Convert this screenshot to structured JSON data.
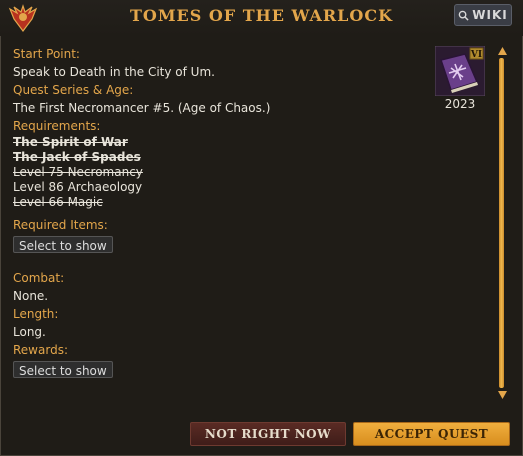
{
  "window": {
    "title": "TOMES OF THE WARLOCK",
    "wiki_label": "WIKI"
  },
  "quest": {
    "start_point_label": "Start Point:",
    "start_point": "Speak to Death in the City of Um.",
    "series_label": "Quest Series & Age:",
    "series": "The First Necromancer #5. (Age of Chaos.)",
    "requirements_label": "Requirements:",
    "requirements": [
      {
        "text": "The Spirit of War",
        "met": true
      },
      {
        "text": "The Jack of Spades",
        "met": true
      },
      {
        "text": "Level 75 Necromancy",
        "met": true
      },
      {
        "text": "Level 86 Archaeology",
        "met": false
      },
      {
        "text": "Level 66 Magic",
        "met": true
      }
    ],
    "required_items_label": "Required Items:",
    "select_to_show": "Select to show",
    "combat_label": "Combat:",
    "combat": "None.",
    "length_label": "Length:",
    "length": "Long.",
    "rewards_label": "Rewards:",
    "rewards_select": "Select to show",
    "year": "2023",
    "badge": "VI"
  },
  "buttons": {
    "decline": "NOT RIGHT NOW",
    "accept": "ACCEPT QUEST"
  },
  "colors": {
    "accent": "#e3a64b",
    "accept": "#f0ae3e",
    "decline": "#4a231e"
  },
  "icons": {
    "logo": "winged-emblem-icon",
    "quest": "spellbook-icon",
    "search": "search-icon"
  }
}
